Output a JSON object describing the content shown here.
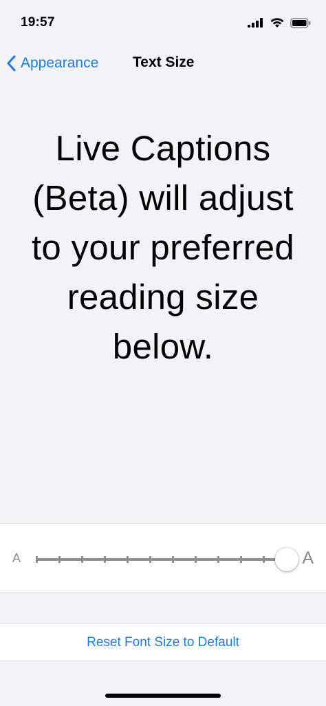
{
  "status_bar": {
    "time": "19:57",
    "icons": [
      "cellular-signal-icon",
      "wifi-icon",
      "battery-icon"
    ]
  },
  "nav": {
    "back_label": "Appearance",
    "title": "Text Size",
    "accent_color": "#1a7ce8"
  },
  "preview": {
    "text": "Live Captions (Beta) will adjust to your preferred reading size below."
  },
  "slider": {
    "min_label": "A",
    "max_label": "A",
    "steps": 12,
    "value_step": 11
  },
  "reset": {
    "label": "Reset Font Size to Default"
  }
}
